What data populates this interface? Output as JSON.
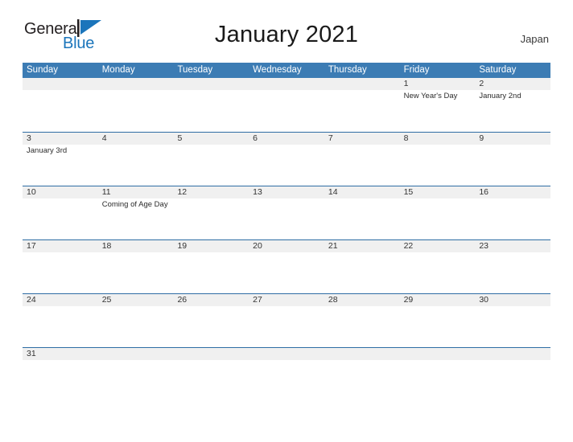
{
  "brand": {
    "name_part1": "General",
    "name_part2": "Blue",
    "flag_icon": "blue-triangle-flag-icon",
    "colors": {
      "dark_text": "#231f20",
      "blue_text": "#1b75bb"
    }
  },
  "header": {
    "title": "January 2021",
    "country": "Japan"
  },
  "calendar": {
    "month": "January",
    "year": "2021",
    "colors": {
      "header_blue": "#3c7cb4",
      "row_divider_blue": "#2e6da4",
      "date_band_gray": "#f0f0f0",
      "text": "#333333"
    },
    "weekdays": [
      "Sunday",
      "Monday",
      "Tuesday",
      "Wednesday",
      "Thursday",
      "Friday",
      "Saturday"
    ],
    "weeks": [
      {
        "days": [
          {
            "date": "",
            "events": []
          },
          {
            "date": "",
            "events": []
          },
          {
            "date": "",
            "events": []
          },
          {
            "date": "",
            "events": []
          },
          {
            "date": "",
            "events": []
          },
          {
            "date": "1",
            "events": [
              "New Year's Day"
            ]
          },
          {
            "date": "2",
            "events": [
              "January 2nd"
            ]
          }
        ]
      },
      {
        "days": [
          {
            "date": "3",
            "events": [
              "January 3rd"
            ]
          },
          {
            "date": "4",
            "events": []
          },
          {
            "date": "5",
            "events": []
          },
          {
            "date": "6",
            "events": []
          },
          {
            "date": "7",
            "events": []
          },
          {
            "date": "8",
            "events": []
          },
          {
            "date": "9",
            "events": []
          }
        ]
      },
      {
        "days": [
          {
            "date": "10",
            "events": []
          },
          {
            "date": "11",
            "events": [
              "Coming of Age Day"
            ]
          },
          {
            "date": "12",
            "events": []
          },
          {
            "date": "13",
            "events": []
          },
          {
            "date": "14",
            "events": []
          },
          {
            "date": "15",
            "events": []
          },
          {
            "date": "16",
            "events": []
          }
        ]
      },
      {
        "days": [
          {
            "date": "17",
            "events": []
          },
          {
            "date": "18",
            "events": []
          },
          {
            "date": "19",
            "events": []
          },
          {
            "date": "20",
            "events": []
          },
          {
            "date": "21",
            "events": []
          },
          {
            "date": "22",
            "events": []
          },
          {
            "date": "23",
            "events": []
          }
        ]
      },
      {
        "days": [
          {
            "date": "24",
            "events": []
          },
          {
            "date": "25",
            "events": []
          },
          {
            "date": "26",
            "events": []
          },
          {
            "date": "27",
            "events": []
          },
          {
            "date": "28",
            "events": []
          },
          {
            "date": "29",
            "events": []
          },
          {
            "date": "30",
            "events": []
          }
        ]
      },
      {
        "days": [
          {
            "date": "31",
            "events": []
          },
          {
            "date": "",
            "events": []
          },
          {
            "date": "",
            "events": []
          },
          {
            "date": "",
            "events": []
          },
          {
            "date": "",
            "events": []
          },
          {
            "date": "",
            "events": []
          },
          {
            "date": "",
            "events": []
          }
        ]
      }
    ]
  }
}
